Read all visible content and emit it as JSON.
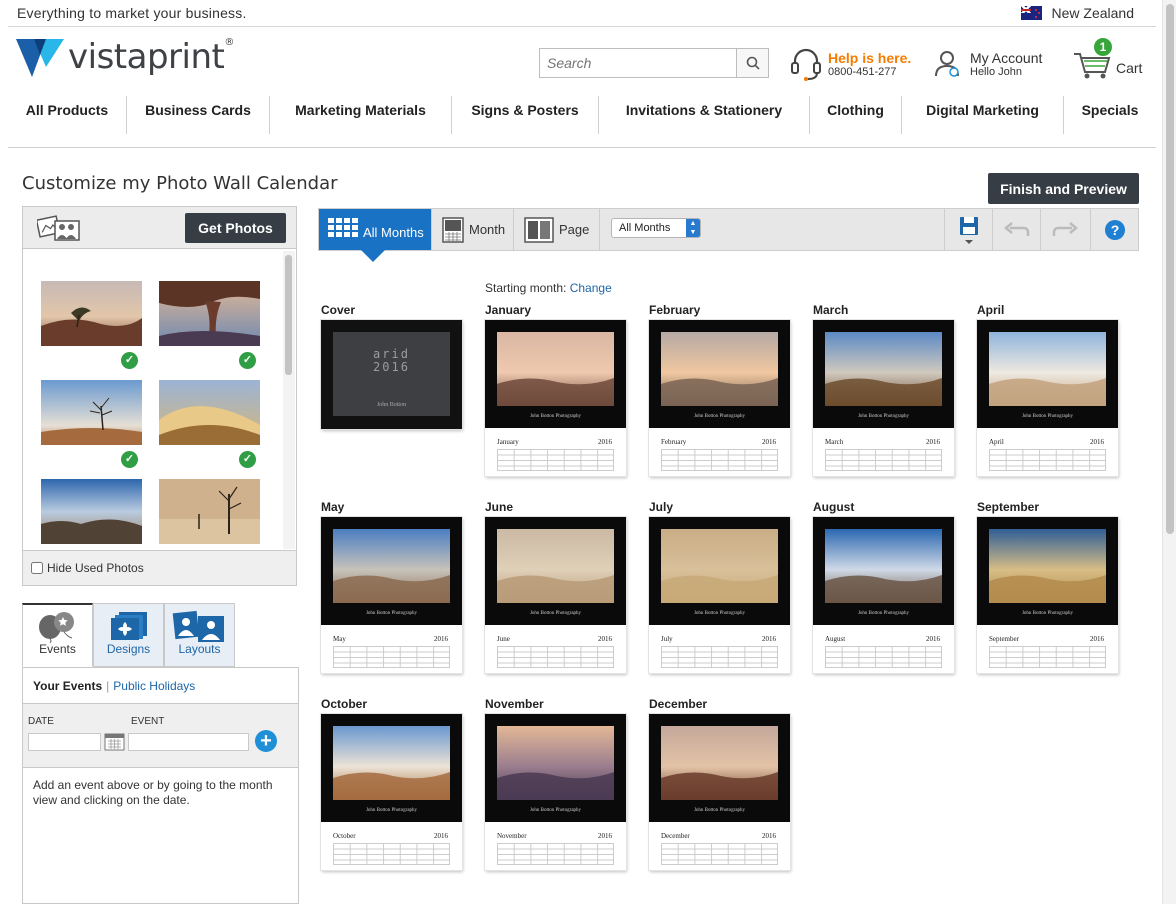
{
  "topbar": {
    "tagline": "Everything to market your business.",
    "region": "New Zealand"
  },
  "header": {
    "logo_text": "vistaprint",
    "logo_reg": "®",
    "search_placeholder": "Search",
    "help_title": "Help is here.",
    "help_phone": "0800-451-277",
    "account_title": "My Account",
    "account_sub": "Hello John",
    "cart_label": "Cart",
    "cart_count": "1"
  },
  "nav": [
    "All Products",
    "Business Cards",
    "Marketing Materials",
    "Signs & Posters",
    "Invitations & Stationery",
    "Clothing",
    "Digital Marketing",
    "Specials"
  ],
  "page": {
    "title": "Customize my Photo Wall Calendar",
    "finish_label": "Finish and Preview"
  },
  "photos": {
    "get_photos_label": "Get Photos",
    "hide_used_label": "Hide Used Photos"
  },
  "event_tabs": [
    "Events",
    "Designs",
    "Layouts"
  ],
  "events": {
    "your_events": "Your Events",
    "separator": "|",
    "public_holidays": "Public Holidays",
    "date_label": "DATE",
    "event_label": "EVENT",
    "help_text": "Add an event above or by going to the month view and clicking on the date."
  },
  "toolbar": {
    "all_months_label": "All Months",
    "month_label": "Month",
    "page_label": "Page",
    "select_value": "All Months"
  },
  "calendar": {
    "starting_month_label": "Starting month:",
    "change_label": "Change",
    "cover_label": "Cover",
    "cover_title_1": "arid",
    "cover_title_2": "2016",
    "cover_signature": "John Botton",
    "credit": "John Botton Photography",
    "year": "2016",
    "months": [
      "January",
      "February",
      "March",
      "April",
      "May",
      "June",
      "July",
      "August",
      "September",
      "October",
      "November",
      "December"
    ]
  }
}
